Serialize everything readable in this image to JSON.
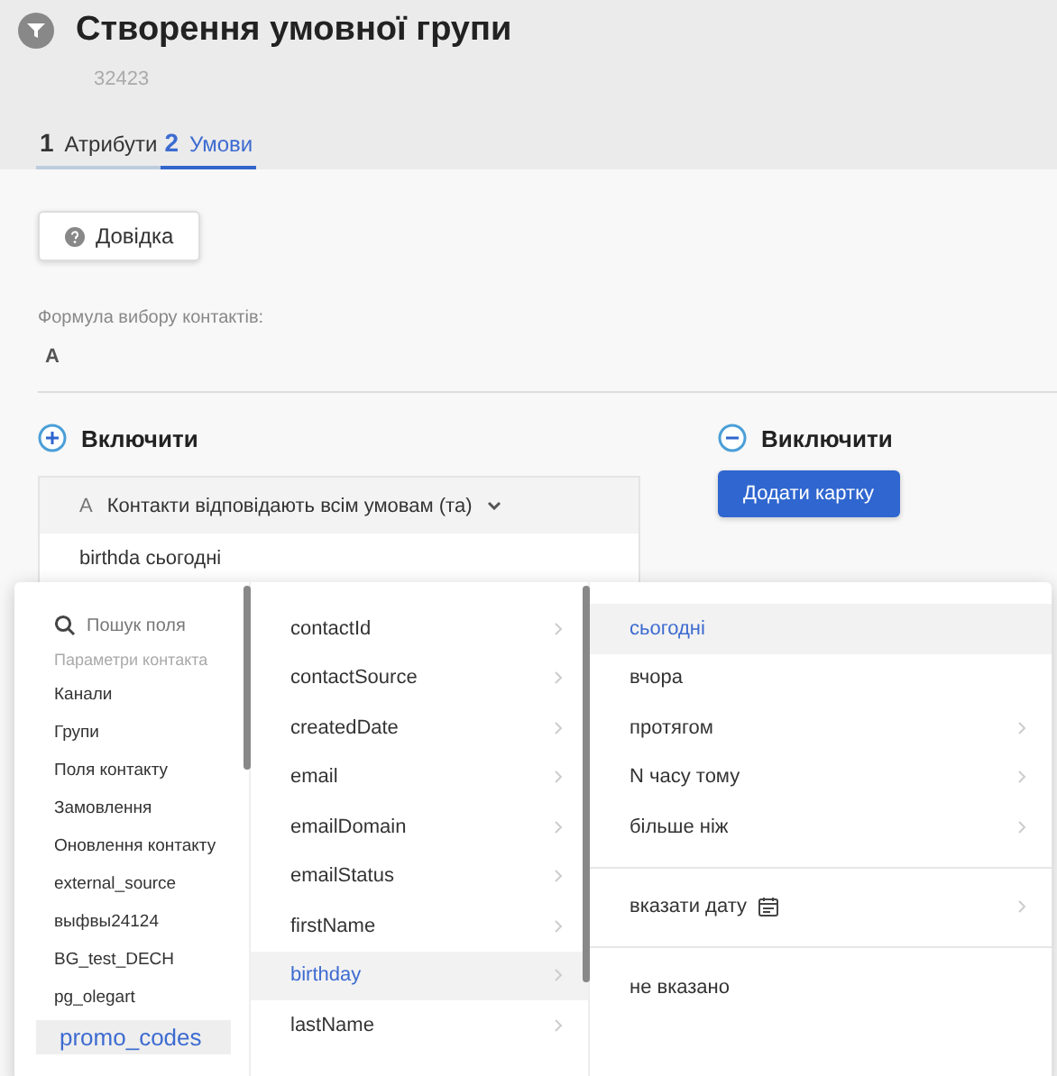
{
  "header": {
    "title": "Створення умовної групи",
    "subtitle": "32423"
  },
  "tabs": [
    {
      "number": "1",
      "label": "Атрибути",
      "selected": false
    },
    {
      "number": "2",
      "label": "Умови",
      "selected": true
    }
  ],
  "help_button": "Довідка",
  "formula": {
    "label": "Формула вибору контактів:",
    "value": "A"
  },
  "include": {
    "title": "Включити",
    "card": {
      "letter": "A",
      "match": "Контакти відповідають всім умовам (та)",
      "condition": "birthda сьогодні"
    }
  },
  "exclude": {
    "title": "Виключити",
    "button": "Додати картку"
  },
  "picker": {
    "search_placeholder": "Пошук поля",
    "section": "Параметри контакта",
    "categories": [
      {
        "label": "Канали",
        "selected": false
      },
      {
        "label": "Групи",
        "selected": false
      },
      {
        "label": "Поля контакту",
        "selected": false
      },
      {
        "label": "Замовлення",
        "selected": false
      },
      {
        "label": "Оновлення контакту",
        "selected": false
      },
      {
        "label": "external_source",
        "selected": false
      },
      {
        "label": "выфвы24124",
        "selected": false
      },
      {
        "label": "BG_test_DECH",
        "selected": false
      },
      {
        "label": "pg_olegart",
        "selected": false
      },
      {
        "label": "promo_codes",
        "selected": true
      }
    ],
    "fields": [
      {
        "label": "contactId",
        "selected": false
      },
      {
        "label": "contactSource",
        "selected": false
      },
      {
        "label": "createdDate",
        "selected": false
      },
      {
        "label": "email",
        "selected": false
      },
      {
        "label": "emailDomain",
        "selected": false
      },
      {
        "label": "emailStatus",
        "selected": false
      },
      {
        "label": "firstName",
        "selected": false
      },
      {
        "label": "birthday",
        "selected": true
      },
      {
        "label": "lastName",
        "selected": false
      }
    ],
    "operator_groups": [
      [
        {
          "label": "сьогодні",
          "selected": true,
          "kind": "plain",
          "submenu": false
        },
        {
          "label": "вчора",
          "selected": false,
          "kind": "plain",
          "submenu": false
        },
        {
          "label": "протягом",
          "selected": false,
          "kind": "plain",
          "submenu": true
        },
        {
          "label": "N часу тому",
          "selected": false,
          "kind": "plain",
          "submenu": true
        },
        {
          "label": "більше ніж",
          "selected": false,
          "kind": "plain",
          "submenu": true
        }
      ],
      [
        {
          "label": "вказати дату",
          "selected": false,
          "kind": "date",
          "submenu": true
        }
      ],
      [
        {
          "label": "не вказано",
          "selected": false,
          "kind": "plain",
          "submenu": false
        }
      ]
    ]
  }
}
